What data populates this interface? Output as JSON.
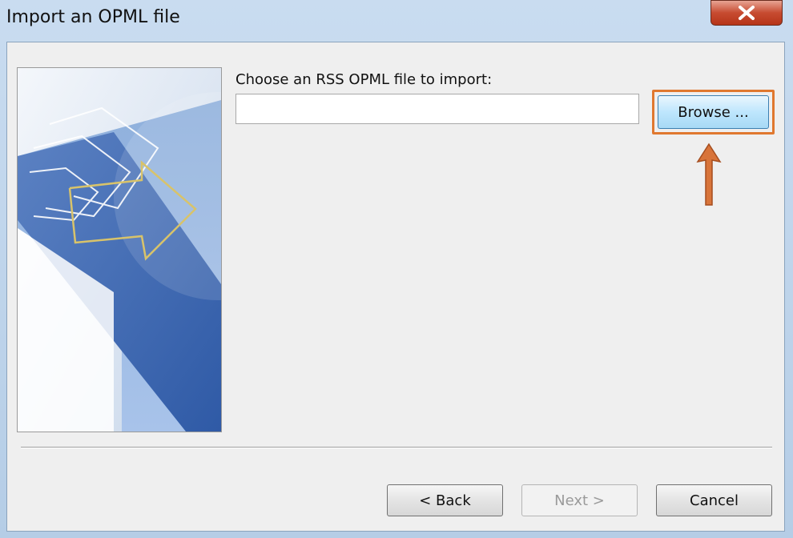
{
  "window": {
    "title": "Import an OPML file"
  },
  "form": {
    "prompt": "Choose an RSS OPML file to import:",
    "file_path_value": "",
    "browse_label": "Browse ..."
  },
  "footer": {
    "back_label": "< Back",
    "next_label": "Next >",
    "next_enabled": false,
    "cancel_label": "Cancel"
  },
  "icons": {
    "close": "close-icon",
    "annotation": "up-arrow-icon"
  },
  "colors": {
    "highlight": "#e0782f",
    "close_button": "#c74b31",
    "browse_button": "#bee6fd"
  }
}
